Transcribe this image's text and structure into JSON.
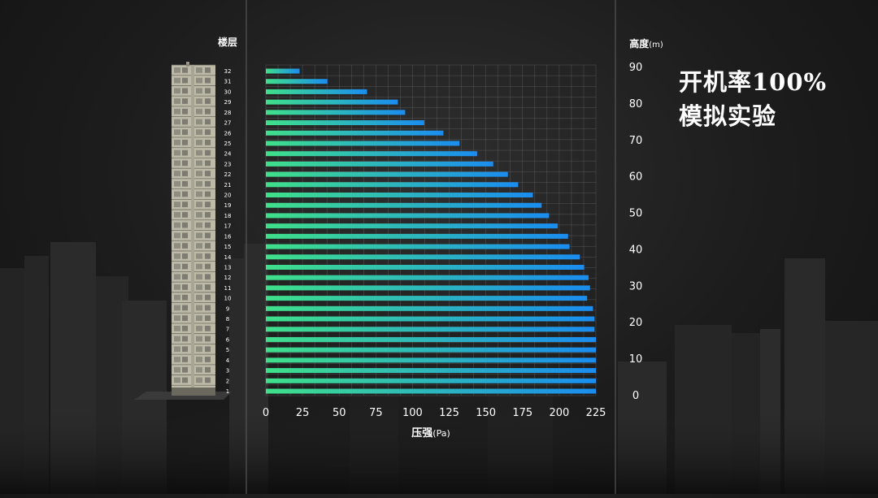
{
  "heading": {
    "line1": "开机率100%",
    "line2": "模拟实验"
  },
  "colors": {
    "bar_start": "#3fe08a",
    "bar_end": "#1a8df0",
    "grid": "#6a6a6a",
    "axis_text": "#ffffff",
    "divider": "#555555"
  },
  "building": {
    "label": "楼层",
    "floors": [
      "1",
      "2",
      "3",
      "4",
      "5",
      "6",
      "7",
      "8",
      "9",
      "10",
      "11",
      "12",
      "13",
      "14",
      "15",
      "16",
      "17",
      "18",
      "19",
      "20",
      "21",
      "22",
      "23",
      "24",
      "25",
      "26",
      "27",
      "28",
      "29",
      "30",
      "31",
      "32"
    ]
  },
  "height_axis": {
    "label": "高度",
    "unit": "m",
    "ticks": [
      "0",
      "10",
      "20",
      "30",
      "40",
      "50",
      "60",
      "70",
      "80",
      "90"
    ]
  },
  "chart_data": {
    "type": "bar",
    "orientation": "horizontal",
    "xlabel": "压强",
    "xunit": "Pa",
    "ylabel": "楼层",
    "xlim": [
      0,
      225
    ],
    "xticks": [
      0,
      25,
      50,
      75,
      100,
      125,
      150,
      175,
      200,
      225
    ],
    "grid": true,
    "categories": [
      "1",
      "2",
      "3",
      "4",
      "5",
      "6",
      "7",
      "8",
      "9",
      "10",
      "11",
      "12",
      "13",
      "14",
      "15",
      "16",
      "17",
      "18",
      "19",
      "20",
      "21",
      "22",
      "23",
      "24",
      "25",
      "26",
      "27",
      "28",
      "29",
      "30",
      "31",
      "32"
    ],
    "values": [
      225,
      225,
      225,
      225,
      225,
      225,
      224,
      224,
      223,
      219,
      221,
      220,
      217,
      214,
      207,
      206,
      199,
      193,
      188,
      182,
      172,
      165,
      155,
      144,
      132,
      121,
      108,
      95,
      90,
      69,
      42,
      23
    ]
  }
}
